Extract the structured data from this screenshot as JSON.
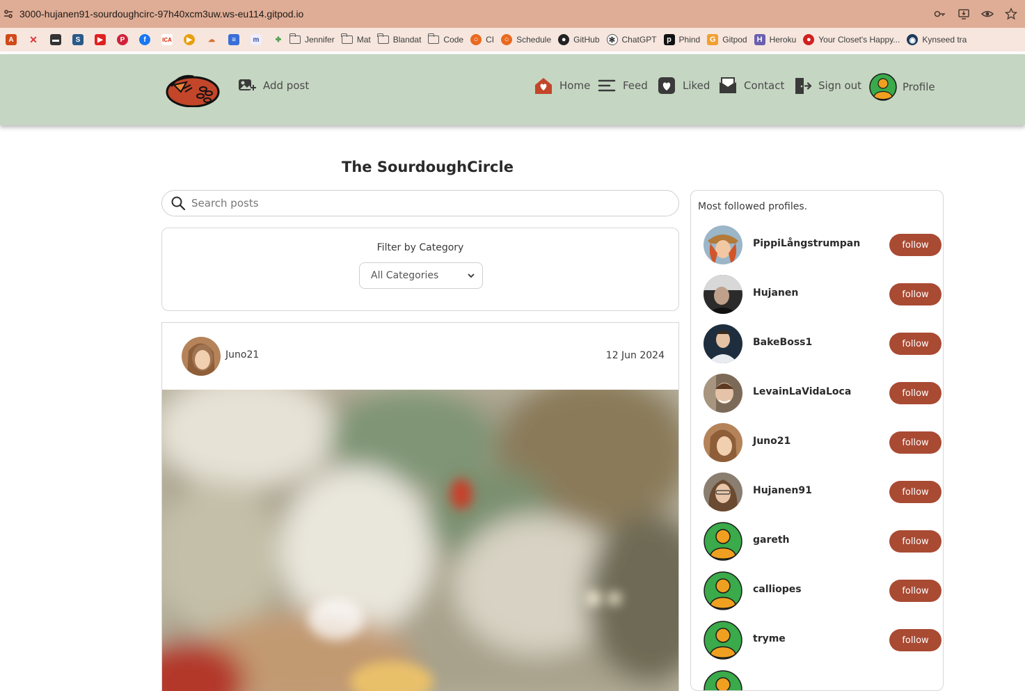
{
  "browser": {
    "url": "3000-hujanen91-sourdoughcirc-97h40xcm3uw.ws-eu114.gitpod.io",
    "bookmarks": [
      {
        "label": "Jennifer",
        "icon": "folder-icon"
      },
      {
        "label": "Mat",
        "icon": "folder-icon"
      },
      {
        "label": "Blandat",
        "icon": "folder-icon"
      },
      {
        "label": "Code",
        "icon": "folder-icon"
      },
      {
        "label": "CI",
        "icon": "ci-icon"
      },
      {
        "label": "Schedule",
        "icon": "schedule-icon"
      },
      {
        "label": "GitHub",
        "icon": "github-icon"
      },
      {
        "label": "ChatGPT",
        "icon": "chatgpt-icon"
      },
      {
        "label": "Phind",
        "icon": "phind-icon"
      },
      {
        "label": "Gitpod",
        "icon": "gitpod-icon"
      },
      {
        "label": "Heroku",
        "icon": "heroku-icon"
      },
      {
        "label": "Your Closet's Happy...",
        "icon": "closet-icon"
      },
      {
        "label": "Kynseed tra",
        "icon": "steam-icon"
      }
    ]
  },
  "nav": {
    "add_post": "Add post",
    "home": "Home",
    "feed": "Feed",
    "liked": "Liked",
    "contact": "Contact",
    "sign_out": "Sign out",
    "profile": "Profile"
  },
  "main": {
    "title": "The SourdoughCircle",
    "search_placeholder": "Search posts",
    "filter_label": "Filter by Category",
    "filter_selected": "All Categories"
  },
  "post": {
    "author": "Juno21",
    "date": "12 Jun 2024"
  },
  "sidebar": {
    "title": "Most followed profiles.",
    "follow_label": "follow",
    "profiles": [
      {
        "name": "PippiLångstrumpan"
      },
      {
        "name": "Hujanen"
      },
      {
        "name": "BakeBoss1"
      },
      {
        "name": "LevainLaVidaLoca"
      },
      {
        "name": "Juno21"
      },
      {
        "name": "Hujanen91"
      },
      {
        "name": "gareth"
      },
      {
        "name": "calliopes"
      },
      {
        "name": "tryme"
      }
    ]
  },
  "colors": {
    "header_bg": "#c5d6c2",
    "accent": "#a94a33",
    "url_bar": "#dfad96"
  }
}
